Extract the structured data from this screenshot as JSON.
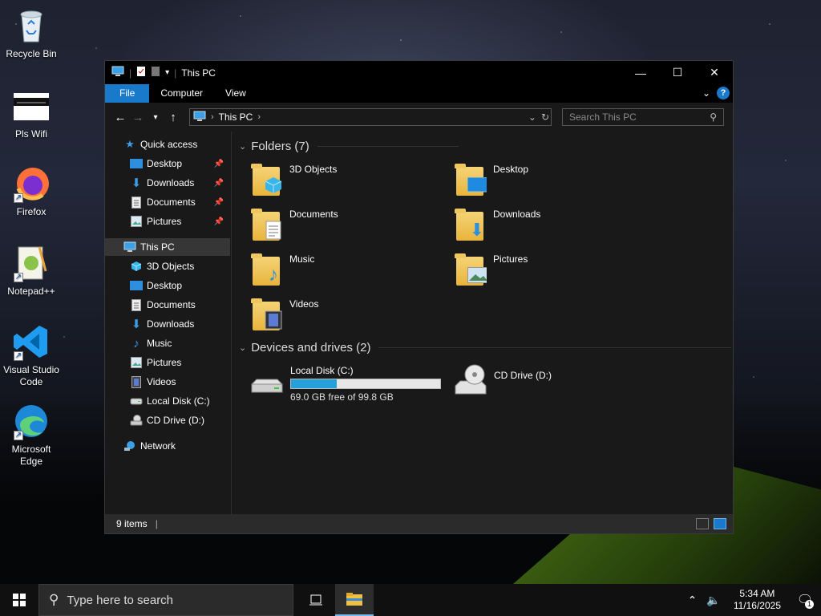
{
  "desktop": {
    "icons": [
      {
        "label": "Recycle Bin",
        "icon": "recycle-bin-icon"
      },
      {
        "label": "Pls Wifi",
        "icon": "image-file-icon"
      },
      {
        "label": "Firefox",
        "icon": "firefox-icon"
      },
      {
        "label": "Notepad++",
        "icon": "notepadpp-icon"
      },
      {
        "label": "Visual Studio Code",
        "icon": "vscode-icon"
      },
      {
        "label": "Microsoft Edge",
        "icon": "edge-icon"
      }
    ]
  },
  "window": {
    "title": "This PC",
    "ribbon": {
      "file": "File",
      "computer": "Computer",
      "view": "View",
      "help": "?"
    },
    "address": {
      "root": "This PC"
    },
    "search_placeholder": "Search This PC",
    "nav": {
      "quick_access": "Quick access",
      "qa_items": [
        "Desktop",
        "Downloads",
        "Documents",
        "Pictures"
      ],
      "this_pc": "This PC",
      "pc_items": [
        "3D Objects",
        "Desktop",
        "Documents",
        "Downloads",
        "Music",
        "Pictures",
        "Videos",
        "Local Disk (C:)",
        "CD Drive (D:)"
      ],
      "network": "Network"
    },
    "folders_header": "Folders (7)",
    "folders": [
      "3D Objects",
      "Desktop",
      "Documents",
      "Downloads",
      "Music",
      "Pictures",
      "Videos"
    ],
    "devices_header": "Devices and drives (2)",
    "drives": [
      {
        "name": "Local Disk (C:)",
        "free": "69.0 GB free of 99.8 GB",
        "used_fraction": 0.309
      },
      {
        "name": "CD Drive (D:)"
      }
    ],
    "status": "9 items"
  },
  "taskbar": {
    "search_placeholder": "Type here to search",
    "time": "5:34 AM",
    "date": "11/16/2025",
    "notification_count": "1"
  },
  "colors": {
    "accent": "#1979ca",
    "drive_bar": "#26a0da"
  }
}
